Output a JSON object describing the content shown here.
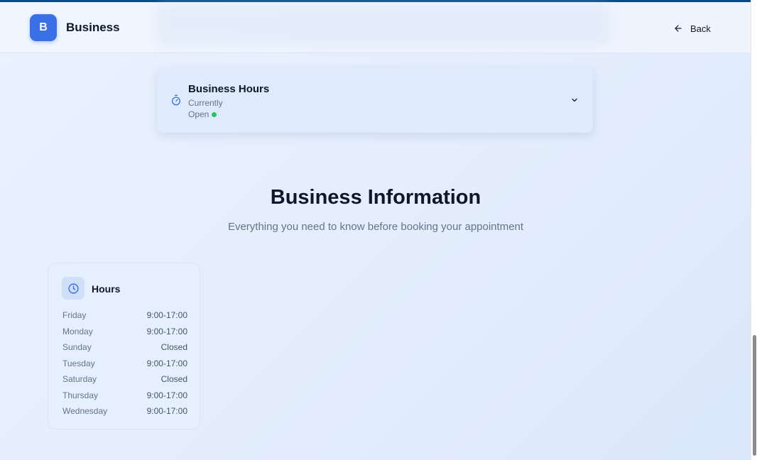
{
  "header": {
    "logo_letter": "B",
    "brand": "Business",
    "back_label": "Back"
  },
  "hours_card": {
    "title": "Business Hours",
    "status_prefix": "Currently",
    "status": "Open",
    "status_color": "#22c55e"
  },
  "section": {
    "title": "Business Information",
    "subtitle": "Everything you need to know before booking your appointment"
  },
  "hours": {
    "title": "Hours",
    "rows": [
      {
        "day": "Friday",
        "time": "9:00-17:00"
      },
      {
        "day": "Monday",
        "time": "9:00-17:00"
      },
      {
        "day": "Sunday",
        "time": "Closed"
      },
      {
        "day": "Tuesday",
        "time": "9:00-17:00"
      },
      {
        "day": "Saturday",
        "time": "Closed"
      },
      {
        "day": "Thursday",
        "time": "9:00-17:00"
      },
      {
        "day": "Wednesday",
        "time": "9:00-17:00"
      }
    ]
  },
  "icons": {
    "back": "arrow-left-icon",
    "hours_card": "stopwatch-icon",
    "expand": "chevron-down-icon",
    "hours": "clock-icon"
  },
  "colors": {
    "accent": "#3b6fe6",
    "text": "#0f172a",
    "muted": "#64748b"
  }
}
